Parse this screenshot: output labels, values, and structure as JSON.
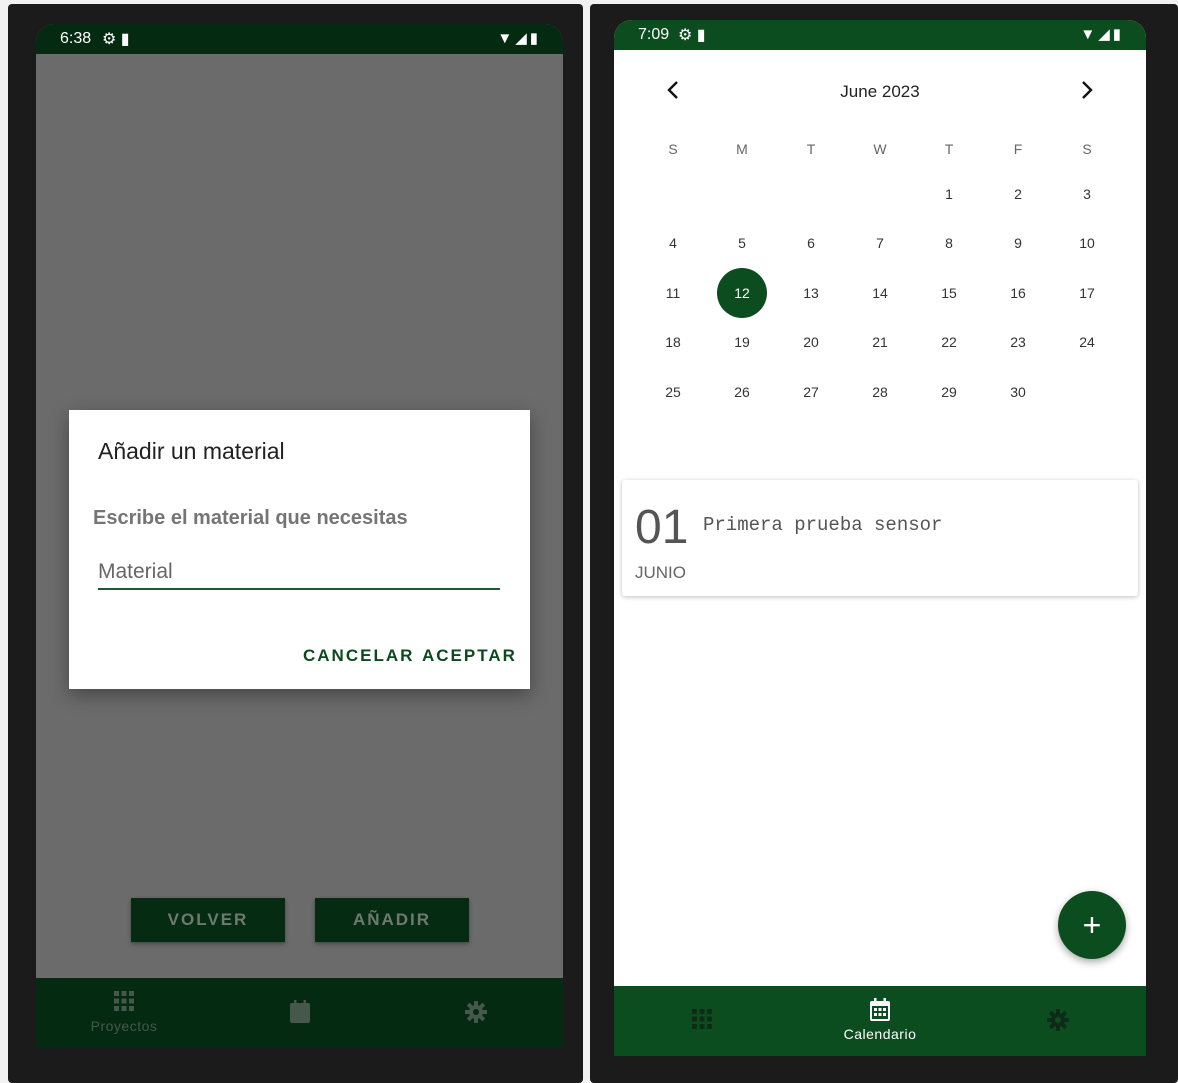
{
  "left_screen": {
    "status": {
      "time": "6:38",
      "left_icons": "⚙ ▮",
      "right_icons": "▼◢▮"
    },
    "dialog": {
      "title": "Añadir un material",
      "prompt": "Escribe el material que necesitas",
      "input_placeholder": "Material",
      "cancel_label": "CANCELAR",
      "accept_label": "ACEPTAR"
    },
    "buttons": {
      "volver": "VOLVER",
      "anadir": "AÑADIR"
    },
    "nav": [
      {
        "icon": "grid-icon",
        "label": "Proyectos"
      },
      {
        "icon": "calendar-icon",
        "label": ""
      },
      {
        "icon": "gear-icon",
        "label": ""
      }
    ]
  },
  "right_screen": {
    "status": {
      "time": "7:09",
      "left_icons": "⚙ ▮",
      "right_icons": "▼◢▮"
    },
    "calendar": {
      "month_label": "June 2023",
      "weekdays": [
        "S",
        "M",
        "T",
        "W",
        "T",
        "F",
        "S"
      ],
      "weeks": [
        [
          "",
          "",
          "",
          "",
          "1",
          "2",
          "3"
        ],
        [
          "4",
          "5",
          "6",
          "7",
          "8",
          "9",
          "10"
        ],
        [
          "11",
          "12",
          "13",
          "14",
          "15",
          "16",
          "17"
        ],
        [
          "18",
          "19",
          "20",
          "21",
          "22",
          "23",
          "24"
        ],
        [
          "25",
          "26",
          "27",
          "28",
          "29",
          "30",
          ""
        ]
      ],
      "selected_day": "12"
    },
    "event": {
      "day": "01",
      "month": "JUNIO",
      "title": "Primera prueba sensor"
    },
    "fab_label": "+",
    "nav": [
      {
        "icon": "grid-icon",
        "label": ""
      },
      {
        "icon": "calendar-icon",
        "label": "Calendario"
      },
      {
        "icon": "gear-icon",
        "label": ""
      }
    ]
  }
}
